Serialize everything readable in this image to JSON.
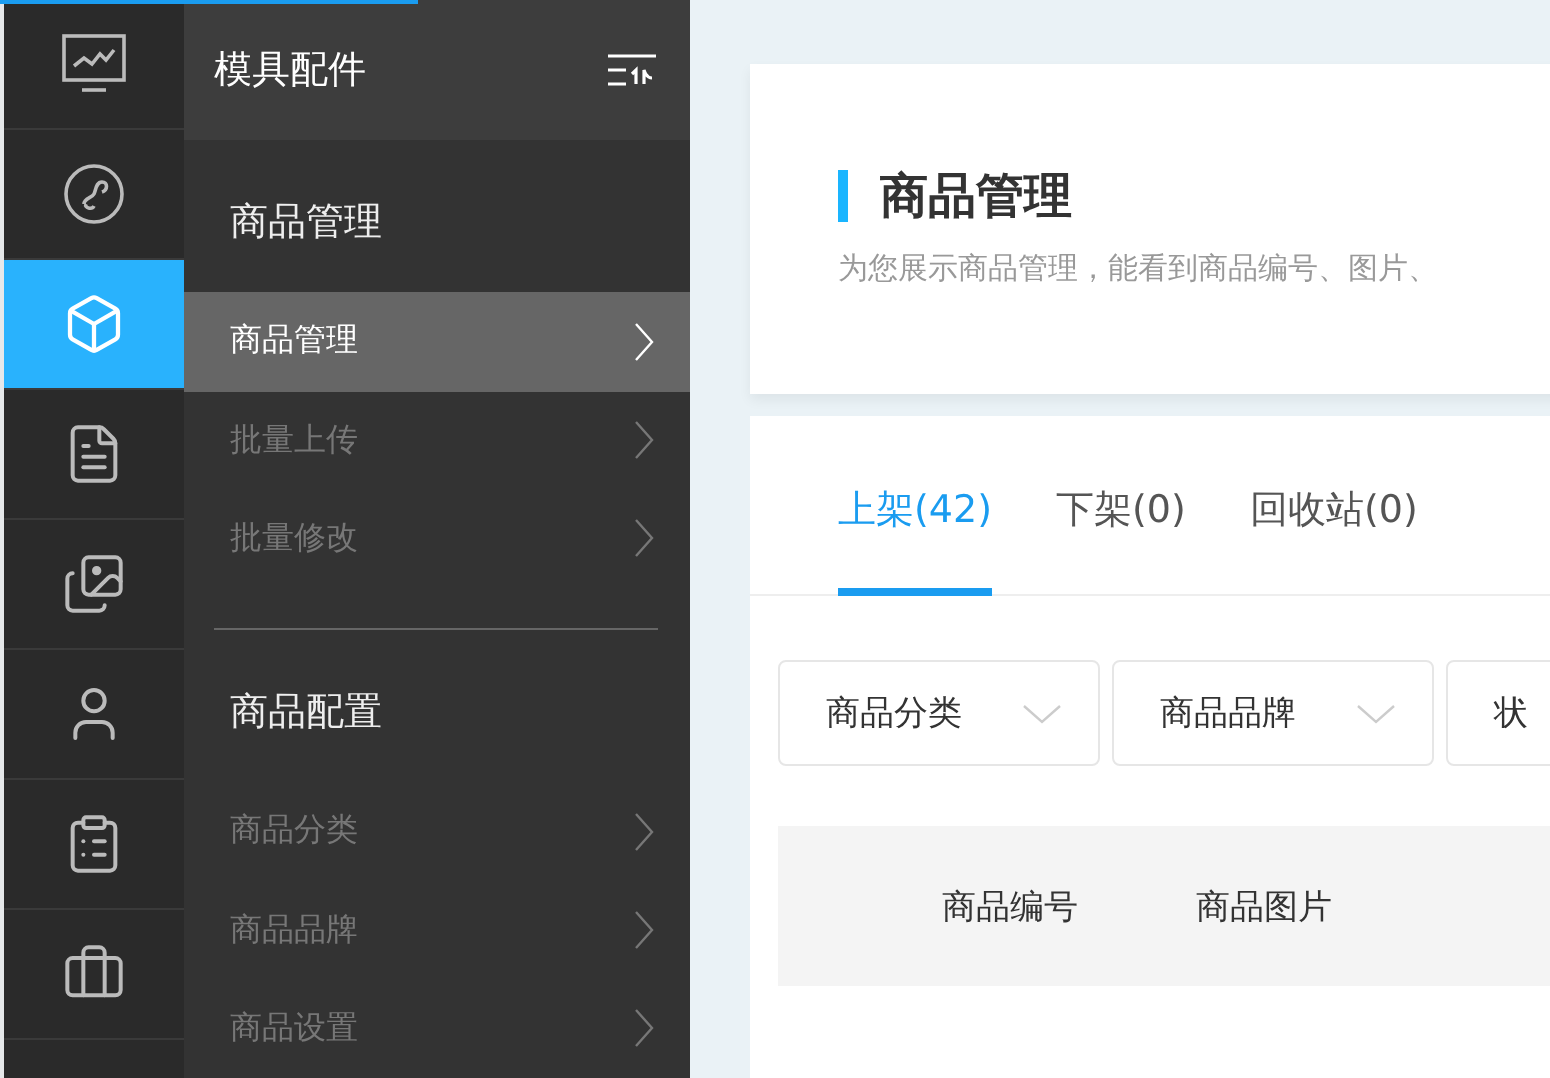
{
  "rail": [
    {
      "selected": false
    },
    {
      "selected": false
    },
    {
      "selected": true
    },
    {
      "selected": false
    },
    {
      "selected": false
    },
    {
      "selected": false
    },
    {
      "selected": false
    },
    {
      "selected": false
    }
  ],
  "progress": {
    "level": 0.27
  },
  "menu": {
    "title": "模具配件",
    "groups": [
      {
        "title": "商品管理",
        "items": [
          {
            "label": "商品管理",
            "selected": true
          },
          {
            "label": "批量上传",
            "selected": false
          },
          {
            "label": "批量修改",
            "selected": false
          }
        ]
      },
      {
        "title": "商品配置",
        "items": [
          {
            "label": "商品分类",
            "selected": false
          },
          {
            "label": "商品品牌",
            "selected": false
          },
          {
            "label": "商品设置",
            "selected": false
          }
        ]
      }
    ]
  },
  "header": {
    "title": "商品管理",
    "subtitle": "为您展示商品管理，能看到商品编号、图片、"
  },
  "tabs": [
    {
      "label": "上架(42)",
      "selected": true
    },
    {
      "label": "下架(0)",
      "selected": false
    },
    {
      "label": "回收站(0)",
      "selected": false
    }
  ],
  "filters": [
    {
      "label": "商品分类"
    },
    {
      "label": "商品品牌"
    },
    {
      "label": "状"
    }
  ],
  "table": {
    "columns": [
      "商品编号",
      "商品图片"
    ]
  }
}
